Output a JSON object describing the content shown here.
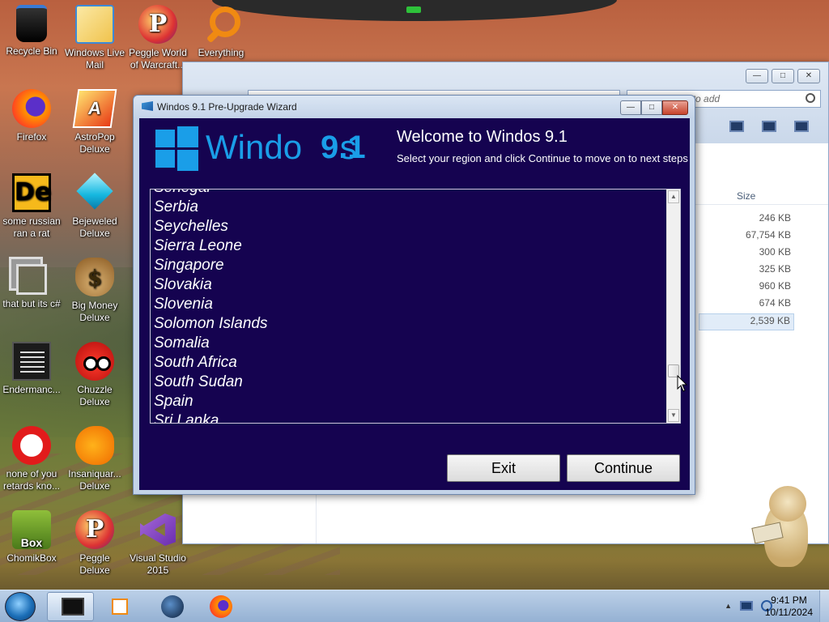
{
  "desktop": {
    "icons": [
      {
        "label": "Recycle Bin"
      },
      {
        "label": "Windows Live Mail"
      },
      {
        "label": "Peggle World of Warcraft..."
      },
      {
        "label": "Everything"
      },
      {
        "label": "Firefox"
      },
      {
        "label": "AstroPop Deluxe"
      },
      {
        "label": "some russian ran a rat"
      },
      {
        "label": "Bejeweled Deluxe"
      },
      {
        "label": "that but its c#"
      },
      {
        "label": "Big Money Deluxe"
      },
      {
        "label": "Endermanc..."
      },
      {
        "label": "Chuzzle Deluxe"
      },
      {
        "label": "none of you retards kno..."
      },
      {
        "label": "Insaniquar... Deluxe"
      },
      {
        "label": "ChomikBox"
      },
      {
        "label": "Peggle Deluxe"
      },
      {
        "label": "Visual Studio 2015"
      }
    ],
    "icon_glyphs": {
      "astro": "A",
      "de": "De",
      "money": "$",
      "peggle": "P",
      "box": "Box"
    }
  },
  "explorer": {
    "search_placeholder": "ple asked me to add",
    "column_size": "Size",
    "sizes": [
      "246 KB",
      "67,754 KB",
      "300 KB",
      "325 KB",
      "960 KB",
      "674 KB",
      "2,539 KB"
    ],
    "window_buttons": {
      "min": "—",
      "max": "□",
      "close": "✕"
    }
  },
  "wizard": {
    "title": "Windos 9.1 Pre-Upgrade Wizard",
    "window_buttons": {
      "min": "—",
      "max": "□",
      "close": "✕"
    },
    "brand_text": "Windo    s",
    "brand_version": "9.1",
    "welcome": "Welcome to Windos 9.1",
    "subtitle": "Select your region and click Continue to move on to next steps",
    "regions": [
      "Senegal",
      "Serbia",
      "Seychelles",
      "Sierra Leone",
      "Singapore",
      "Slovakia",
      "Slovenia",
      "Solomon Islands",
      "Somalia",
      "South Africa",
      "South Sudan",
      "Spain",
      "Sri Lanka"
    ],
    "scroll_up": "▲",
    "scroll_down": "▼",
    "exit_label": "Exit",
    "continue_label": "Continue"
  },
  "taskbar": {
    "time": "9:41 PM",
    "date": "10/11/2024",
    "tray_up": "▲"
  },
  "colors": {
    "wizard_bg": "#150350",
    "brand_blue": "#1a9ee8"
  }
}
